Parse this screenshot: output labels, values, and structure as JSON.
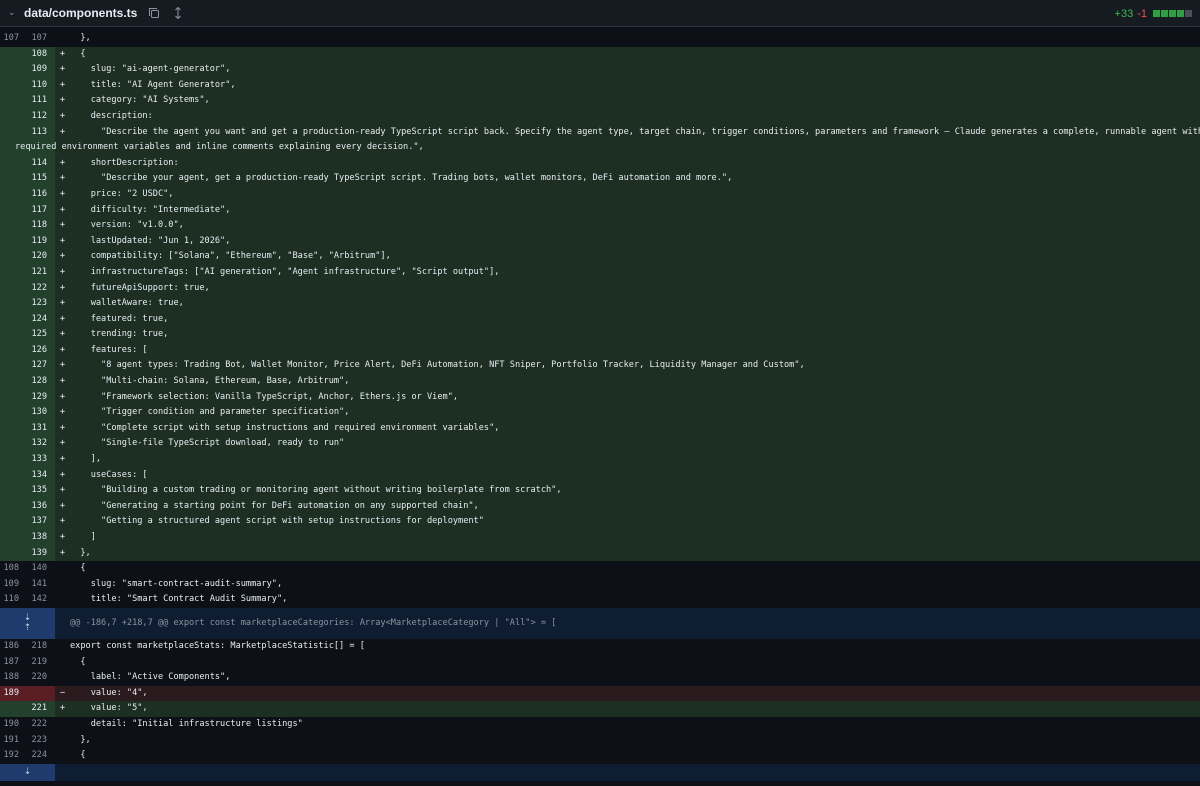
{
  "file": {
    "path": "data/components.ts",
    "additions": "+33",
    "deletions": "-1"
  },
  "lines": [
    {
      "type": "ctx",
      "o": "107",
      "n": "107",
      "code": "  },"
    },
    {
      "type": "add",
      "n": "108",
      "code": "  {"
    },
    {
      "type": "add",
      "n": "109",
      "code": "    slug: \"ai-agent-generator\","
    },
    {
      "type": "add",
      "n": "110",
      "code": "    title: \"AI Agent Generator\","
    },
    {
      "type": "add",
      "n": "111",
      "code": "    category: \"AI Systems\","
    },
    {
      "type": "add",
      "n": "112",
      "code": "    description:"
    },
    {
      "type": "add",
      "n": "113",
      "code": "      \"Describe the agent you want and get a production-ready TypeScript script back. Specify the agent type, target chain, trigger conditions, parameters and framework — Claude generates a complete, runnable agent with setup instructions,"
    },
    {
      "type": "addwrap",
      "code": "required environment variables and inline comments explaining every decision.\","
    },
    {
      "type": "add",
      "n": "114",
      "code": "    shortDescription:"
    },
    {
      "type": "add",
      "n": "115",
      "code": "      \"Describe your agent, get a production-ready TypeScript script. Trading bots, wallet monitors, DeFi automation and more.\","
    },
    {
      "type": "add",
      "n": "116",
      "code": "    price: \"2 USDC\","
    },
    {
      "type": "add",
      "n": "117",
      "code": "    difficulty: \"Intermediate\","
    },
    {
      "type": "add",
      "n": "118",
      "code": "    version: \"v1.0.0\","
    },
    {
      "type": "add",
      "n": "119",
      "code": "    lastUpdated: \"Jun 1, 2026\","
    },
    {
      "type": "add",
      "n": "120",
      "code": "    compatibility: [\"Solana\", \"Ethereum\", \"Base\", \"Arbitrum\"],"
    },
    {
      "type": "add",
      "n": "121",
      "code": "    infrastructureTags: [\"AI generation\", \"Agent infrastructure\", \"Script output\"],"
    },
    {
      "type": "add",
      "n": "122",
      "code": "    futureApiSupport: true,"
    },
    {
      "type": "add",
      "n": "123",
      "code": "    walletAware: true,"
    },
    {
      "type": "add",
      "n": "124",
      "code": "    featured: true,"
    },
    {
      "type": "add",
      "n": "125",
      "code": "    trending: true,"
    },
    {
      "type": "add",
      "n": "126",
      "code": "    features: ["
    },
    {
      "type": "add",
      "n": "127",
      "code": "      \"8 agent types: Trading Bot, Wallet Monitor, Price Alert, DeFi Automation, NFT Sniper, Portfolio Tracker, Liquidity Manager and Custom\","
    },
    {
      "type": "add",
      "n": "128",
      "code": "      \"Multi-chain: Solana, Ethereum, Base, Arbitrum\","
    },
    {
      "type": "add",
      "n": "129",
      "code": "      \"Framework selection: Vanilla TypeScript, Anchor, Ethers.js or Viem\","
    },
    {
      "type": "add",
      "n": "130",
      "code": "      \"Trigger condition and parameter specification\","
    },
    {
      "type": "add",
      "n": "131",
      "code": "      \"Complete script with setup instructions and required environment variables\","
    },
    {
      "type": "add",
      "n": "132",
      "code": "      \"Single-file TypeScript download, ready to run\""
    },
    {
      "type": "add",
      "n": "133",
      "code": "    ],"
    },
    {
      "type": "add",
      "n": "134",
      "code": "    useCases: ["
    },
    {
      "type": "add",
      "n": "135",
      "code": "      \"Building a custom trading or monitoring agent without writing boilerplate from scratch\","
    },
    {
      "type": "add",
      "n": "136",
      "code": "      \"Generating a starting point for DeFi automation on any supported chain\","
    },
    {
      "type": "add",
      "n": "137",
      "code": "      \"Getting a structured agent script with setup instructions for deployment\""
    },
    {
      "type": "add",
      "n": "138",
      "code": "    ]"
    },
    {
      "type": "add",
      "n": "139",
      "code": "  },"
    },
    {
      "type": "ctx",
      "o": "108",
      "n": "140",
      "code": "  {"
    },
    {
      "type": "ctx",
      "o": "109",
      "n": "141",
      "code": "    slug: \"smart-contract-audit-summary\","
    },
    {
      "type": "ctx",
      "o": "110",
      "n": "142",
      "code": "    title: \"Smart Contract Audit Summary\","
    },
    {
      "type": "hunk",
      "code": "@@ -186,7 +218,7 @@ export const marketplaceCategories: Array<MarketplaceCategory | \"All\"> = ["
    },
    {
      "type": "ctx",
      "o": "186",
      "n": "218",
      "code": "export const marketplaceStats: MarketplaceStatistic[] = ["
    },
    {
      "type": "ctx",
      "o": "187",
      "n": "219",
      "code": "  {"
    },
    {
      "type": "ctx",
      "o": "188",
      "n": "220",
      "code": "    label: \"Active Components\","
    },
    {
      "type": "del",
      "o": "189",
      "code": "    value: \"4\","
    },
    {
      "type": "add",
      "n": "221",
      "code": "    value: \"5\","
    },
    {
      "type": "ctx",
      "o": "190",
      "n": "222",
      "code": "    detail: \"Initial infrastructure listings\""
    },
    {
      "type": "ctx",
      "o": "191",
      "n": "223",
      "code": "  },"
    },
    {
      "type": "ctx",
      "o": "192",
      "n": "224",
      "code": "  {"
    }
  ]
}
